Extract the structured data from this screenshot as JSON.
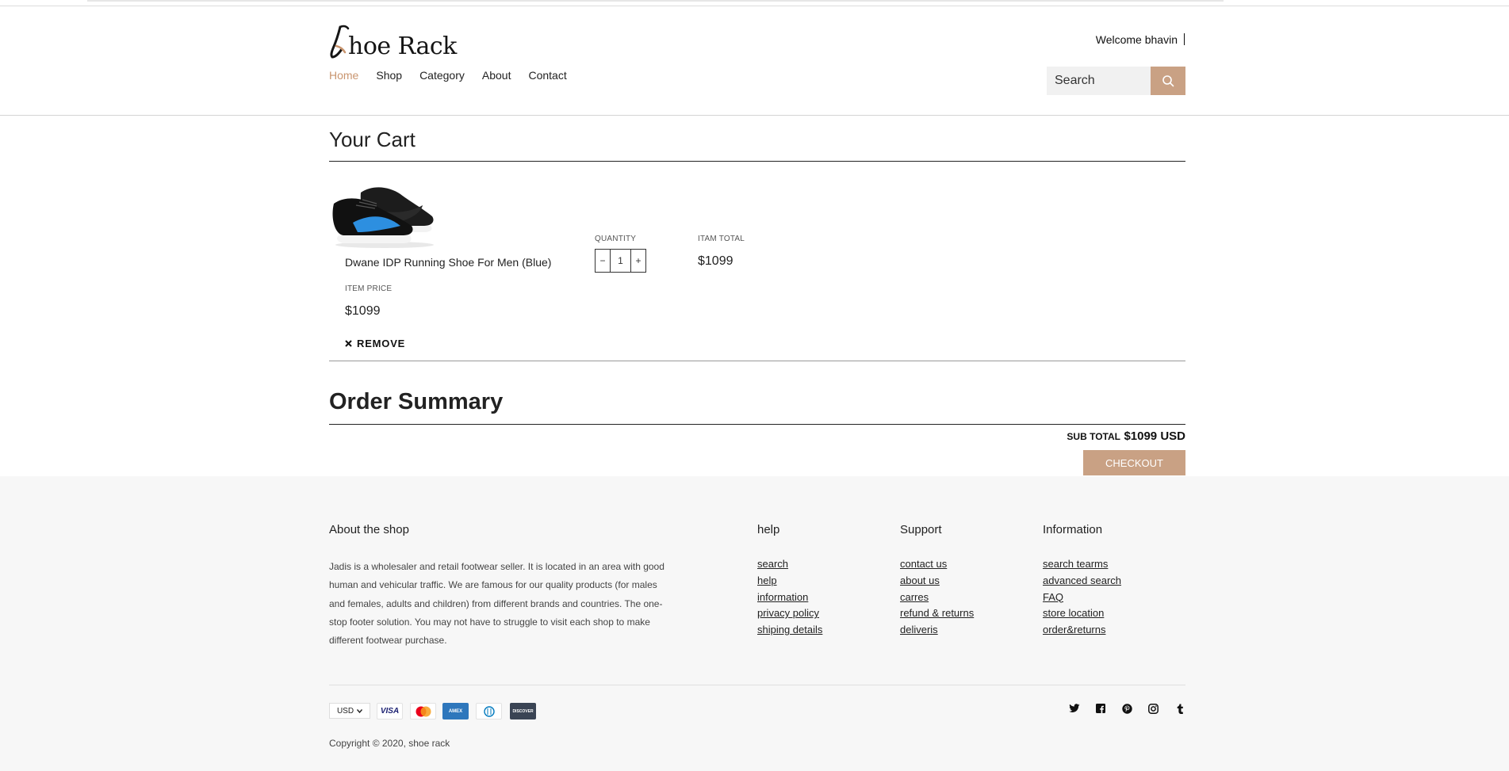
{
  "header": {
    "logo_text": "hoe Rack",
    "nav": [
      "Home",
      "Shop",
      "Category",
      "About",
      "Contact"
    ],
    "welcome": "Welcome bhavin",
    "search_placeholder": "Search"
  },
  "cart": {
    "title": "Your Cart",
    "item": {
      "name": "Dwane IDP Running Shoe For Men (Blue)",
      "item_price_label": "ITEM PRICE",
      "item_price": "$1099",
      "quantity_label": "QUANTITY",
      "quantity": "1",
      "decrement": "−",
      "increment": "+",
      "total_label": "ITAM TOTAL",
      "total": "$1099",
      "remove_label": "REMOVE"
    }
  },
  "summary": {
    "title": "Order Summary",
    "subtotal_label": "SUB TOTAL",
    "subtotal_value": "$1099 USD",
    "checkout_label": "CHECKOUT"
  },
  "footer": {
    "about_heading": "About the shop",
    "about_text": "Jadis is a wholesaler and retail footwear seller. It is located in an area with good human and vehicular traffic. We are famous for our quality products (for males and females, adults and children) from different brands and countries. The one-stop footer solution. You may not have to struggle to visit each shop to make different footwear purchase.",
    "columns": [
      {
        "heading": "help",
        "links": [
          "search",
          "help",
          "information",
          "privacy policy",
          "shiping details"
        ]
      },
      {
        "heading": "Support",
        "links": [
          "contact us",
          "about us",
          "carres",
          "refund & returns",
          "deliveris"
        ]
      },
      {
        "heading": "Information",
        "links": [
          "search tearms",
          "advanced search",
          "FAQ",
          "store location",
          "order&returns"
        ]
      }
    ],
    "currency": "USD",
    "payment_methods": [
      "VISA",
      "MasterCard",
      "AMEX",
      "Diners Club",
      "DISCOVER"
    ],
    "social_icons": [
      "twitter-icon",
      "facebook-icon",
      "pinterest-icon",
      "instagram-icon",
      "tumblr-icon"
    ],
    "copyright": "Copyright © 2020, shoe rack"
  },
  "colors": {
    "accent": "#c9a184",
    "nav_active": "#c9956f",
    "footer_bg": "#f7f7f7"
  }
}
